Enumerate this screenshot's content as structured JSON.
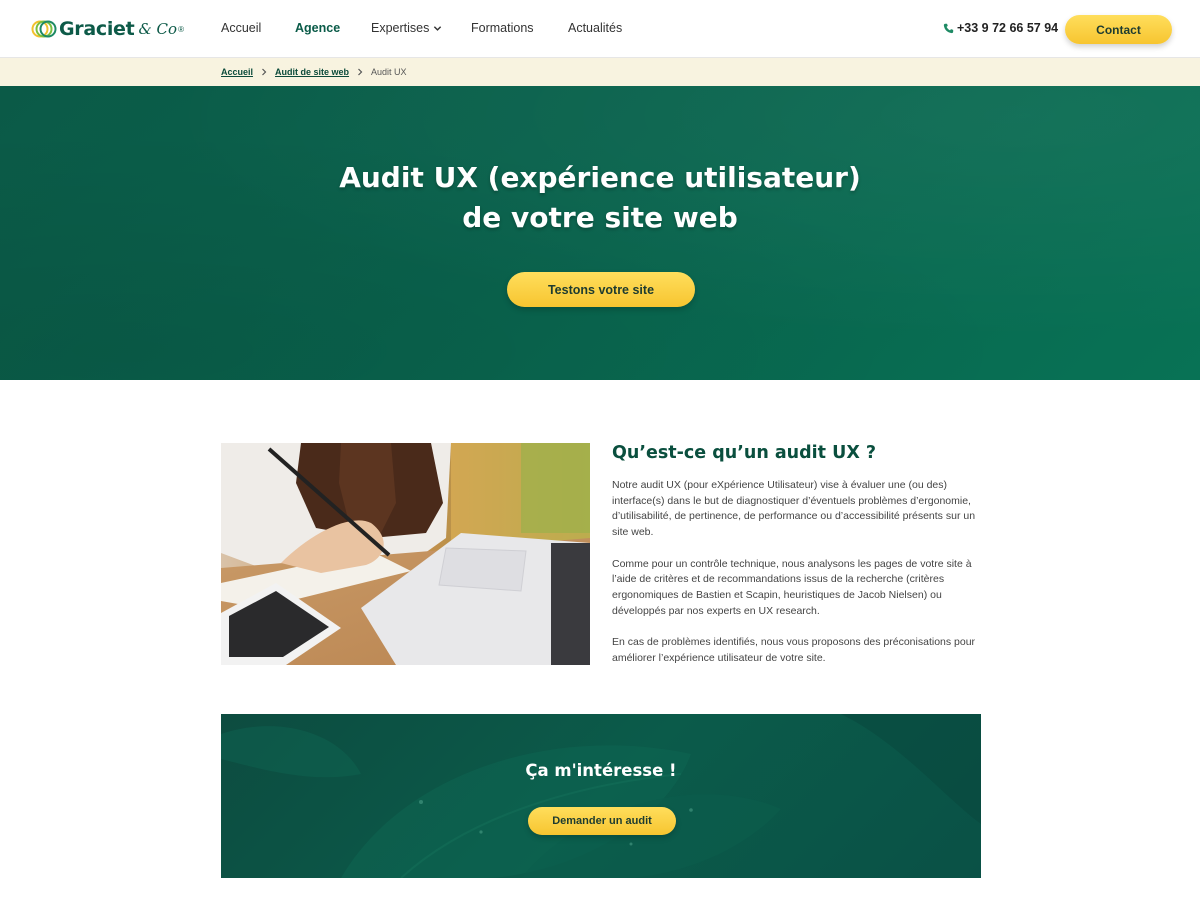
{
  "header": {
    "logo": {
      "name": "Graciet",
      "suffix": "& Co",
      "reg": "®"
    },
    "nav": [
      {
        "label": "Accueil"
      },
      {
        "label": "Agence"
      },
      {
        "label": "Expertises"
      },
      {
        "label": "Formations"
      },
      {
        "label": "Actualités"
      }
    ],
    "phone": "+33 9 72 66 57 94",
    "contact_label": "Contact"
  },
  "breadcrumb": {
    "items": [
      {
        "label": "Accueil"
      },
      {
        "label": "Audit de site web"
      }
    ],
    "current": "Audit UX"
  },
  "hero": {
    "title_line1": "Audit UX (expérience utilisateur)",
    "title_line2": "de votre site web",
    "cta_label": "Testons votre site"
  },
  "intro": {
    "title": "Qu’est-ce qu’un audit UX ?",
    "paragraphs": [
      "Notre audit UX (pour eXpérience Utilisateur) vise à évaluer une (ou des) interface(s) dans le but de diagnostiquer d’éventuels problèmes d’ergonomie, d’utilisabilité, de pertinence, de performance ou d’accessibilité présents sur un site web.",
      "Comme pour un contrôle technique, nous analysons les pages de votre site à l’aide de critères et de recommandations issus de la recherche (critères ergonomiques de Bastien et Scapin, heuristiques de Jacob Nielsen) ou développés par nos experts en UX research.",
      "En cas de problèmes identifiés, nous vous proposons des préconisations pour améliorer l’expérience utilisateur de votre site."
    ]
  },
  "cta_banner": {
    "title": "Ça m'intéresse !",
    "button_label": "Demander un audit"
  },
  "colors": {
    "brand_green": "#0a5b48",
    "accent_yellow": "#f9cf3f",
    "breadcrumb_bg": "#f8f3e0"
  }
}
